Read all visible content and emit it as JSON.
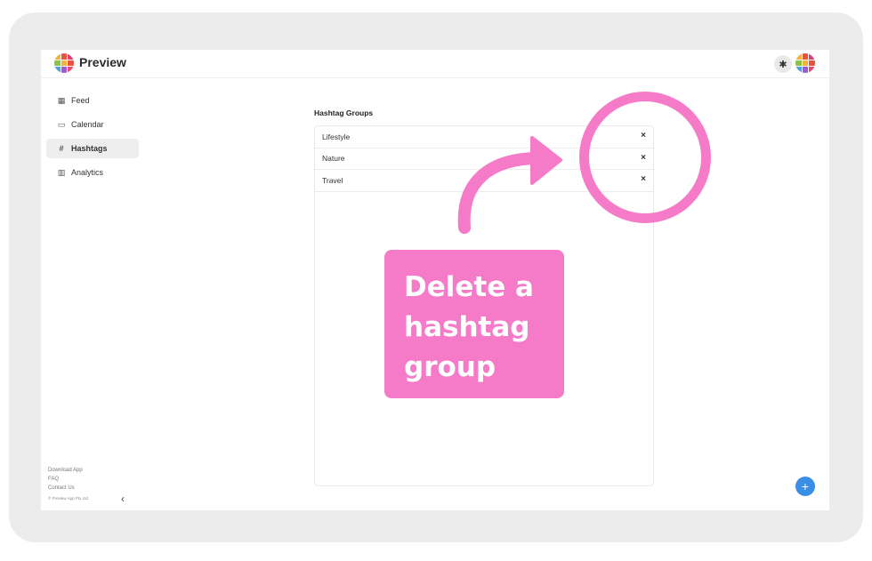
{
  "app": {
    "title": "Preview"
  },
  "colors": {
    "accent_pink": "#f57bc9",
    "fab_blue": "#3a8ee6"
  },
  "logo_colors": [
    "#f2b33d",
    "#e8533f",
    "#d94177",
    "#8bc34a",
    "#f2b33d",
    "#e8533f",
    "#4aa3df",
    "#9c5bd1",
    "#e94a6a"
  ],
  "header": {
    "settings_icon": "gear-icon"
  },
  "sidebar": {
    "items": [
      {
        "label": "Feed",
        "icon": "grid-icon",
        "glyph": "▦"
      },
      {
        "label": "Calendar",
        "icon": "calendar-icon",
        "glyph": "▭"
      },
      {
        "label": "Hashtags",
        "icon": "hash-icon",
        "glyph": "#"
      },
      {
        "label": "Analytics",
        "icon": "bar-chart-icon",
        "glyph": "▥"
      }
    ],
    "active": "Hashtags",
    "footer": {
      "download": "Download App",
      "faq": "FAQ",
      "contact": "Contact Us",
      "copyright": "© Preview App Pty Ltd"
    },
    "collapse_glyph": "‹"
  },
  "main": {
    "section_title": "Hashtag Groups",
    "groups": [
      {
        "name": "Lifestyle"
      },
      {
        "name": "Nature"
      },
      {
        "name": "Travel"
      }
    ],
    "delete_glyph": "×"
  },
  "fab": {
    "glyph": "+"
  },
  "annotation": {
    "line1": "Delete a",
    "line2": "hashtag",
    "line3": "group"
  }
}
